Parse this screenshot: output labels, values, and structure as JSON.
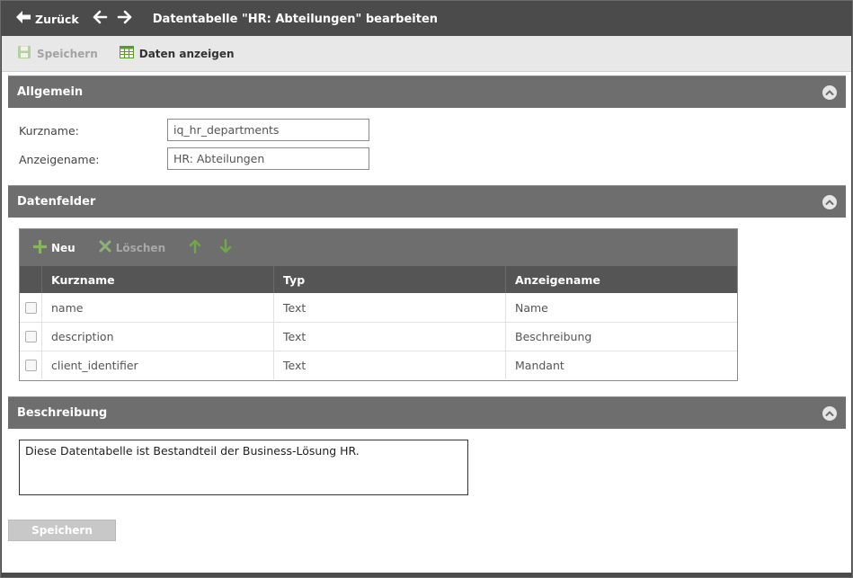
{
  "titlebar": {
    "back_label": "Zurück",
    "title": "Datentabelle \"HR: Abteilungen\" bearbeiten"
  },
  "toolbar": {
    "save_label": "Speichern",
    "show_data_label": "Daten anzeigen"
  },
  "general": {
    "heading": "Allgemein",
    "shortname_label": "Kurzname:",
    "shortname_value": "iq_hr_departments",
    "displayname_label": "Anzeigename:",
    "displayname_value": "HR: Abteilungen"
  },
  "datafields": {
    "heading": "Datenfelder",
    "new_label": "Neu",
    "delete_label": "Löschen",
    "columns": [
      "Kurzname",
      "Typ",
      "Anzeigename"
    ],
    "rows": [
      [
        "name",
        "Text",
        "Name"
      ],
      [
        "description",
        "Text",
        "Beschreibung"
      ],
      [
        "client_identifier",
        "Text",
        "Mandant"
      ]
    ]
  },
  "description": {
    "heading": "Beschreibung",
    "text": "Diese Datentabelle ist Bestandteil der Business-Lösung HR."
  },
  "footer": {
    "save_label": "Speichern"
  },
  "colors": {
    "titlebar": "#4b4b4b",
    "section_header": "#6e6e6e",
    "accent_green": "#7bc142",
    "disabled_text": "#a3a3a3"
  }
}
